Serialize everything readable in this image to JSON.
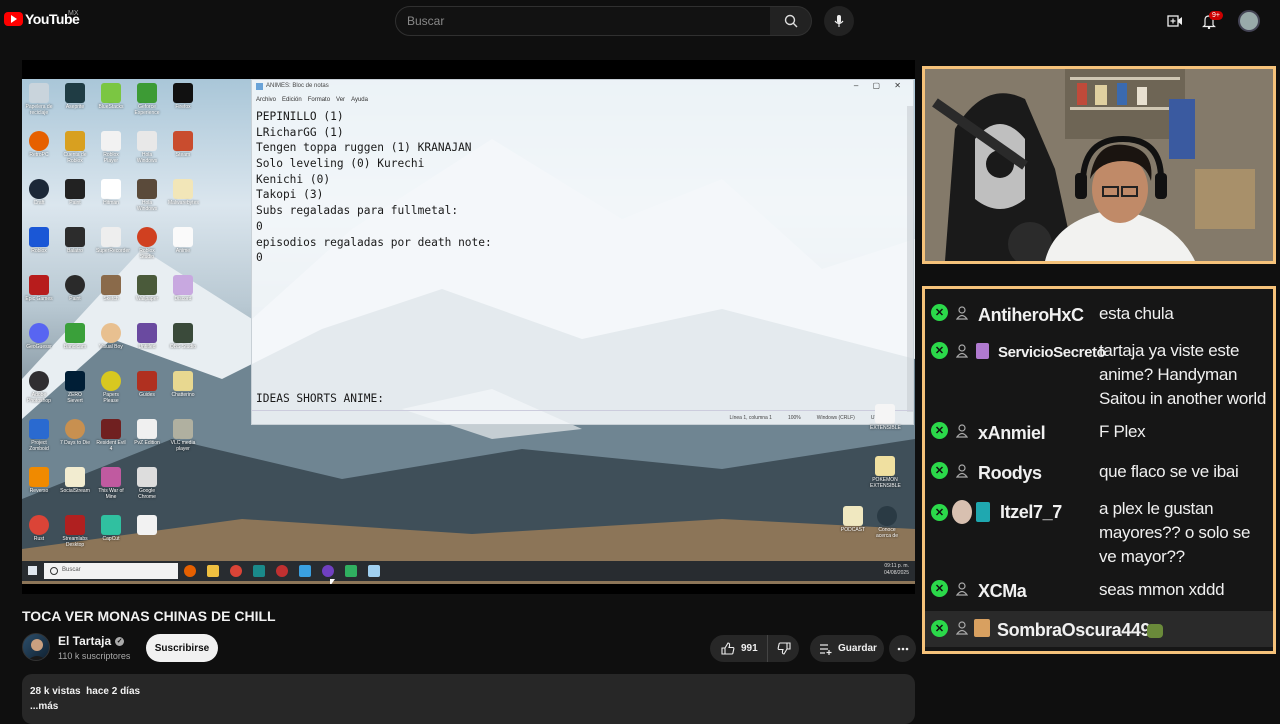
{
  "header": {
    "logo_text": "YouTube",
    "logo_region": "MX",
    "search_placeholder": "Buscar",
    "notification_count": "9+"
  },
  "video": {
    "title": "TOCA VER MONAS CHINAS DE CHILL",
    "channel_name": "El Tartaja",
    "subscribers": "110 k suscriptores",
    "subscribe_label": "Suscribirse",
    "likes": "991",
    "save_label": "Guardar",
    "views_date": "28 k vistas  hace 2 días",
    "more_label": "...más"
  },
  "stream": {
    "notepad": {
      "title": "ANIMES: Bloc de notas",
      "menu": [
        "Archivo",
        "Edición",
        "Formato",
        "Ver",
        "Ayuda"
      ],
      "lines": [
        "PEPINILLO (1)",
        "LRicharGG (1)",
        "Tengen toppa ruggen (1) KRANAJAN",
        "Solo leveling (0) Kurechi",
        "Kenichi (0)",
        "Takopi (3)",
        "Subs regaladas para fullmetal:",
        "0",
        "episodios regaladas por death note:",
        "0",
        "",
        "",
        "",
        "",
        "",
        "",
        "",
        "",
        "IDEAS SHORTS ANIME:"
      ],
      "status": [
        "Línea 1, columna 1",
        "100%",
        "Windows (CRLF)",
        "UTF-8"
      ]
    },
    "taskbar": {
      "search_placeholder": "Buscar",
      "time": "09:11 p. m.",
      "date": "04/08/2025"
    },
    "desktop_icons": [
      "Papelera de reciclaje",
      "Aseprite",
      "BlueStacks",
      "Geforce Experience",
      "Firefox",
      "RetroPC",
      "Cuenta de Roblox",
      "Roblox Player",
      "Hola Windows",
      "Steam",
      "Craft",
      "Paint",
      "Hitman",
      "Hola Windows",
      "Malwarebytes",
      "Roblox",
      "Balatro",
      "SuperRecorder",
      "Roblox Studio",
      "Anime",
      "Epic Games",
      "Paint",
      "Sketch",
      "Wallpaper",
      "Discord",
      "GeoGuessr",
      "Bandicam",
      "Visual Boy",
      "Untitled",
      "OBS Studio",
      "Adobe Photoshop",
      "ZERO Sievert",
      "Papers Please",
      "Guides",
      "Chatterino",
      "Project Zomboid",
      "7 Days to Die",
      "Resident Evil 4",
      "PvZ Edition",
      "VLC media player",
      "Reverso",
      "SocialStream",
      "This War of Mine",
      "Google Chrome",
      "Rust",
      "Streamlabs Desktop",
      "CapCut"
    ],
    "right_icons": [
      "EXTENSIBLE",
      "POKEMON EXTENSIBLE",
      "PODCAST",
      "Conoce acerca de"
    ]
  },
  "chat": {
    "messages": [
      {
        "user": "AntiheroHxC",
        "text": "esta chula"
      },
      {
        "user": "ServicioSecreto",
        "text": "tartaja ya viste este anime? Handyman Saitou in another world"
      },
      {
        "user": "xAnmiel",
        "text": "F Plex"
      },
      {
        "user": "Roodys",
        "text": "que flaco se ve ibai"
      },
      {
        "user": "Itzel7_7",
        "text": "a plex le gustan mayores?? o solo se ve mayor??"
      },
      {
        "user": "XCMa",
        "text": "seas mmon xddd"
      },
      {
        "user": "SombraOscura449",
        "text": ""
      }
    ]
  },
  "colors": {
    "background": "#0f0f0f",
    "chat_border": "#f5c27a",
    "check_green": "#2bd94a",
    "youtube_red": "#ff0000"
  },
  "icons": [
    "youtube-logo-icon",
    "search-icon",
    "mic-icon",
    "create-icon",
    "bell-icon",
    "like-icon",
    "dislike-icon",
    "save-icon",
    "more-icon",
    "verified-icon"
  ]
}
